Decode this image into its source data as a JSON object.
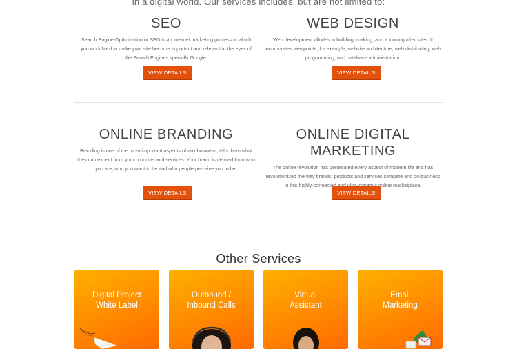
{
  "intro": {
    "text": "in a digital world. Our services includes, but are not limited to:"
  },
  "services": [
    {
      "title": "SEO",
      "description": "Search Engine Optimization or SEO is an internet marketing process in which you work hard to make your site become important and relevant in the eyes of the Search Engines specially Google.",
      "button": "VIEW DETAILS"
    },
    {
      "title": "WEB DESIGN",
      "description": "Web development alludes in building, making, and a looking after sites. It incorporates viewpoints, for example, website architecture, web distributing, web programming, and database administration.",
      "button": "VIEW DETAILS"
    },
    {
      "title": "ONLINE BRANDING",
      "description": "Branding  is one of the most important aspects of any business, tells them what they can expect from your products and services. Your brand is derived from who you are, who you want to be and who people perceive you to be.",
      "button": "VIEW DETAILS"
    },
    {
      "title": "ONLINE DIGITAL MARKETING",
      "description": "The online revolution has penetrated every aspect of modern life and has revolutionized the way brands, products and services compete and do business in this highly-connected and ultra-dynamic online marketplace.",
      "button": "VIEW DETAILS"
    }
  ],
  "other_services": {
    "title": "Other Services",
    "cards": [
      {
        "line1": "Digital Project",
        "line2": "White Label",
        "icon": "paper-plane-icon"
      },
      {
        "line1": "Outbound /",
        "line2": "Inbound Calls",
        "icon": "headset-agent-icon"
      },
      {
        "line1": "Virtual",
        "line2": "Assistant",
        "icon": "assistant-woman-icon"
      },
      {
        "line1": "Email",
        "line2": "Marketing",
        "icon": "envelopes-icon"
      }
    ]
  },
  "colors": {
    "accent_button": "#e3520d",
    "card_gradient_start": "#ffb000",
    "card_gradient_end": "#ff6a00"
  }
}
